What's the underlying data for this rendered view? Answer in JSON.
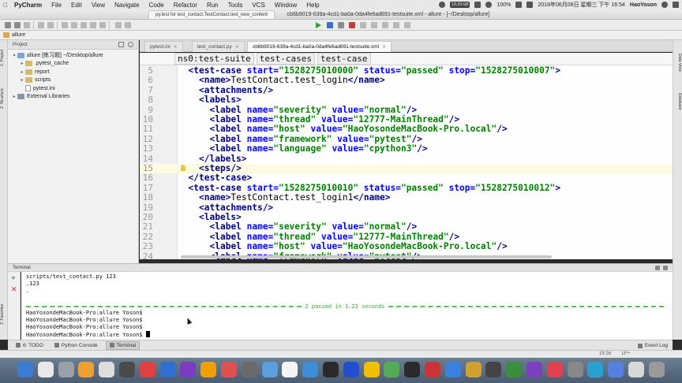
{
  "menubar": {
    "app_name": "PyCharm",
    "items": [
      "File",
      "Edit",
      "View",
      "Navigate",
      "Code",
      "Refactor",
      "Run",
      "Tools",
      "VCS",
      "Window",
      "Help"
    ],
    "memory": "13.29 GB",
    "battery": "100%",
    "datetime": "2018年06月06日 星期三 下午 16:54",
    "user": "HaoYoson"
  },
  "window": {
    "mini_tab": "py.test for test_contact.TestContact.test_new_content",
    "title": "cb6b9019-639a-4cd1-ba0a-0da4fe6ad691-testsuite.xml - allure - [~/Desktop/allure]"
  },
  "navbar": {
    "project_name": "allure"
  },
  "left_stripe": {
    "project_tab": "1: Project",
    "structure_tab": "2: Structure",
    "favorites_tab": "2: Favorites"
  },
  "right_stripe": {
    "data_view": "Data View",
    "database": "Database"
  },
  "project_panel": {
    "header": "Project",
    "tree": [
      {
        "label": "allure [练习题]  ~/Desktop/allure",
        "level": 0,
        "arrow": "▾",
        "kind": "folder-blue"
      },
      {
        "label": ".pytest_cache",
        "level": 1,
        "arrow": "▸",
        "kind": "folder"
      },
      {
        "label": "report",
        "level": 1,
        "arrow": "▸",
        "kind": "folder"
      },
      {
        "label": "scripts",
        "level": 1,
        "arrow": "▸",
        "kind": "folder"
      },
      {
        "label": "pytest.ini",
        "level": 1,
        "arrow": "",
        "kind": "file"
      },
      {
        "label": "External Libraries",
        "level": 0,
        "arrow": "▸",
        "kind": "lib"
      }
    ]
  },
  "editor_tabs": [
    {
      "label": "pytest.ini",
      "active": false
    },
    {
      "label": "test_contact.py",
      "active": false
    },
    {
      "label": "cb6b9019-639a-4cd1-ba0a-0da4fe6ad691-testsuite.xml",
      "active": true
    }
  ],
  "xml_breadcrumbs": [
    "ns0:test-suite",
    "test-cases",
    "test-case"
  ],
  "code_lines": [
    {
      "n": "5",
      "indent": 1,
      "parts": [
        [
          "tag",
          "<test-case "
        ],
        [
          "attr",
          "start="
        ],
        [
          "val",
          "\"1528275010000\" "
        ],
        [
          "attr",
          "status="
        ],
        [
          "val",
          "\"passed\" "
        ],
        [
          "attr",
          "stop="
        ],
        [
          "val",
          "\"1528275010007\""
        ],
        [
          "tag",
          ">"
        ]
      ]
    },
    {
      "n": "6",
      "indent": 2,
      "parts": [
        [
          "tag",
          "<name>"
        ],
        [
          "txt",
          "TestContact.test_login"
        ],
        [
          "tag",
          "</name>"
        ]
      ]
    },
    {
      "n": "7",
      "indent": 2,
      "parts": [
        [
          "tag",
          "<attachments/>"
        ]
      ]
    },
    {
      "n": "8",
      "indent": 2,
      "parts": [
        [
          "tag",
          "<labels>"
        ]
      ]
    },
    {
      "n": "9",
      "indent": 3,
      "parts": [
        [
          "tag",
          "<label "
        ],
        [
          "attr",
          "name="
        ],
        [
          "val",
          "\"severity\" "
        ],
        [
          "attr",
          "value="
        ],
        [
          "val",
          "\"normal\""
        ],
        [
          "tag",
          "/>"
        ]
      ]
    },
    {
      "n": "10",
      "indent": 3,
      "parts": [
        [
          "tag",
          "<label "
        ],
        [
          "attr",
          "name="
        ],
        [
          "val",
          "\"thread\" "
        ],
        [
          "attr",
          "value="
        ],
        [
          "val",
          "\"12777-MainThread\""
        ],
        [
          "tag",
          "/>"
        ]
      ]
    },
    {
      "n": "11",
      "indent": 3,
      "parts": [
        [
          "tag",
          "<label "
        ],
        [
          "attr",
          "name="
        ],
        [
          "val",
          "\"host\" "
        ],
        [
          "attr",
          "value="
        ],
        [
          "val",
          "\"HaoYosondeMacBook-Pro.local\""
        ],
        [
          "tag",
          "/>"
        ]
      ]
    },
    {
      "n": "12",
      "indent": 3,
      "parts": [
        [
          "tag",
          "<label "
        ],
        [
          "attr",
          "name="
        ],
        [
          "val",
          "\"framework\" "
        ],
        [
          "attr",
          "value="
        ],
        [
          "val",
          "\"pytest\""
        ],
        [
          "tag",
          "/>"
        ]
      ]
    },
    {
      "n": "13",
      "indent": 3,
      "parts": [
        [
          "tag",
          "<label "
        ],
        [
          "attr",
          "name="
        ],
        [
          "val",
          "\"language\" "
        ],
        [
          "attr",
          "value="
        ],
        [
          "val",
          "\"cpython3\""
        ],
        [
          "tag",
          "/>"
        ]
      ]
    },
    {
      "n": "14",
      "indent": 2,
      "parts": [
        [
          "tag",
          "</labels>"
        ]
      ]
    },
    {
      "n": "15",
      "indent": 2,
      "parts": [
        [
          "tag",
          "<steps/>"
        ]
      ],
      "highlight": true
    },
    {
      "n": "16",
      "indent": 1,
      "parts": [
        [
          "tag",
          "</test-case>"
        ]
      ]
    },
    {
      "n": "17",
      "indent": 1,
      "parts": [
        [
          "tag",
          "<test-case "
        ],
        [
          "attr",
          "start="
        ],
        [
          "val",
          "\"1528275010010\" "
        ],
        [
          "attr",
          "status="
        ],
        [
          "val",
          "\"passed\" "
        ],
        [
          "attr",
          "stop="
        ],
        [
          "val",
          "\"1528275010012\""
        ],
        [
          "tag",
          ">"
        ]
      ]
    },
    {
      "n": "18",
      "indent": 2,
      "parts": [
        [
          "tag",
          "<name>"
        ],
        [
          "txt",
          "TestContact.test_login1"
        ],
        [
          "tag",
          "</name>"
        ]
      ]
    },
    {
      "n": "19",
      "indent": 2,
      "parts": [
        [
          "tag",
          "<attachments/>"
        ]
      ]
    },
    {
      "n": "20",
      "indent": 2,
      "parts": [
        [
          "tag",
          "<labels>"
        ]
      ]
    },
    {
      "n": "21",
      "indent": 3,
      "parts": [
        [
          "tag",
          "<label "
        ],
        [
          "attr",
          "name="
        ],
        [
          "val",
          "\"severity\" "
        ],
        [
          "attr",
          "value="
        ],
        [
          "val",
          "\"normal\""
        ],
        [
          "tag",
          "/>"
        ]
      ]
    },
    {
      "n": "22",
      "indent": 3,
      "parts": [
        [
          "tag",
          "<label "
        ],
        [
          "attr",
          "name="
        ],
        [
          "val",
          "\"thread\" "
        ],
        [
          "attr",
          "value="
        ],
        [
          "val",
          "\"12777-MainThread\""
        ],
        [
          "tag",
          "/>"
        ]
      ]
    },
    {
      "n": "23",
      "indent": 3,
      "parts": [
        [
          "tag",
          "<label "
        ],
        [
          "attr",
          "name="
        ],
        [
          "val",
          "\"host\" "
        ],
        [
          "attr",
          "value="
        ],
        [
          "val",
          "\"HaoYosondeMacBook-Pro.local\""
        ],
        [
          "tag",
          "/>"
        ]
      ]
    },
    {
      "n": "24",
      "indent": 3,
      "parts": [
        [
          "tag",
          "<label "
        ],
        [
          "attr",
          "name="
        ],
        [
          "val",
          "\"framework\" "
        ],
        [
          "attr",
          "value="
        ],
        [
          "val",
          "\"pytest\""
        ],
        [
          "tag",
          "/>"
        ]
      ]
    }
  ],
  "terminal": {
    "header": "Terminal",
    "lines_top": [
      "scripts/test_contact.py 123",
      ".123",
      "."
    ],
    "passed_message": "2 passed in 1.22 seconds",
    "prompts": [
      "HaoYosondeMacBook-Pro:allure Yoson$",
      "HaoYosondeMacBook-Pro:allure Yoson$",
      "HaoYosondeMacBook-Pro:allure Yoson$",
      "HaoYosondeMacBook-Pro:allure Yoson$"
    ]
  },
  "bottom_tabs": [
    {
      "label": "6: TODO",
      "active": false
    },
    {
      "label": "Python Console",
      "active": false
    },
    {
      "label": "Terminal",
      "active": true
    }
  ],
  "event_log": "Event Log",
  "status": {
    "position": "15:16",
    "line_sep": "LF÷"
  },
  "dock_colors": [
    "#3b7bd6",
    "#e8e8e8",
    "#9aa0a8",
    "#f0a030",
    "#dddddd",
    "#4a4a4a",
    "#e04040",
    "#3070d0",
    "#7a3cc0",
    "#f0a000",
    "#e05050",
    "#6a6a6a",
    "#5aa0e0",
    "#f5f5f5",
    "#3a8fd8",
    "#2a2a2a",
    "#2050d0",
    "#f0c000",
    "#55aa55",
    "#2a2a2a",
    "#cc3333",
    "#3a80e0",
    "#d0a030",
    "#444444",
    "#3a8f3a",
    "#7a40c0",
    "#e04050",
    "#888888",
    "#2aa0d0",
    "#5580e0",
    "#d8d8d8",
    "#9a9a9a"
  ]
}
